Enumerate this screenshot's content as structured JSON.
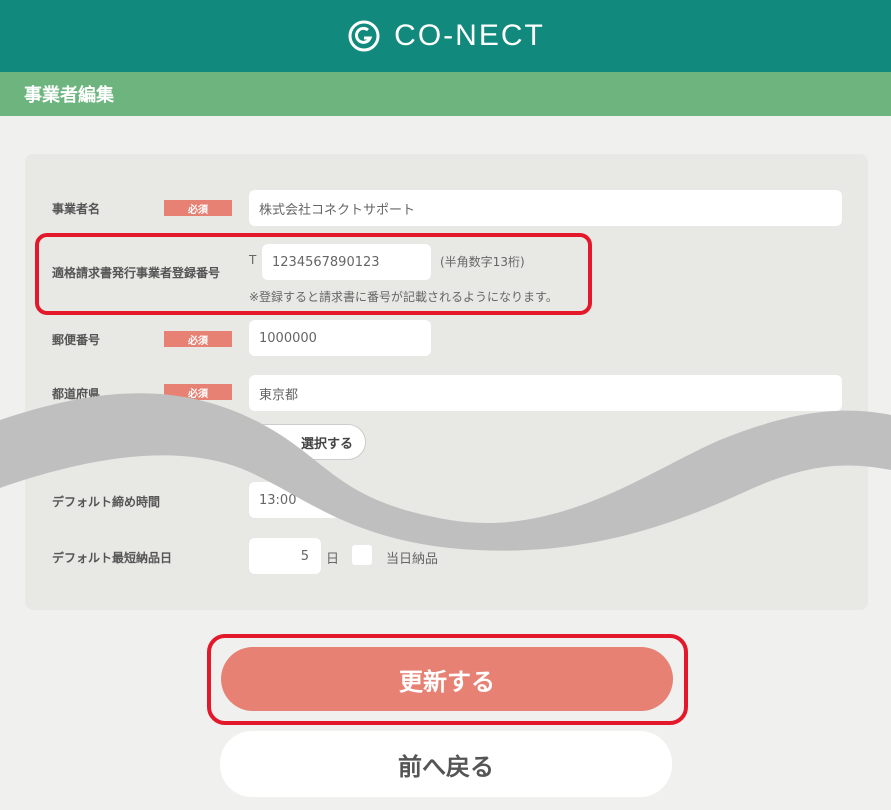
{
  "header": {
    "brand": "CO-NECT"
  },
  "page": {
    "title": "事業者編集"
  },
  "form": {
    "required_label": "必須",
    "business_name": {
      "label": "事業者名",
      "value": "株式会社コネクトサポート"
    },
    "invoice_number": {
      "label": "適格請求書発行事業者登録番号",
      "prefix": "T",
      "value": "1234567890123",
      "hint": "(半角数字13桁)",
      "note": "※登録すると請求書に番号が記載されるようになります。"
    },
    "postal_code": {
      "label": "郵便番号",
      "value": "1000000"
    },
    "prefecture": {
      "label": "都道府県",
      "value": "東京都"
    },
    "select_button": {
      "label": "選択する"
    },
    "default_closing_time": {
      "label": "デフォルト締め時間",
      "value": "13:00"
    },
    "default_min_delivery": {
      "label": "デフォルト最短納品日",
      "value": "5",
      "unit": "日",
      "sameday_label": "当日納品"
    }
  },
  "actions": {
    "update": "更新する",
    "back": "前へ戻る"
  },
  "colors": {
    "header": "#12897d",
    "titlebar": "#6db47e",
    "accent": "#e68174",
    "highlight": "#e3192b"
  }
}
